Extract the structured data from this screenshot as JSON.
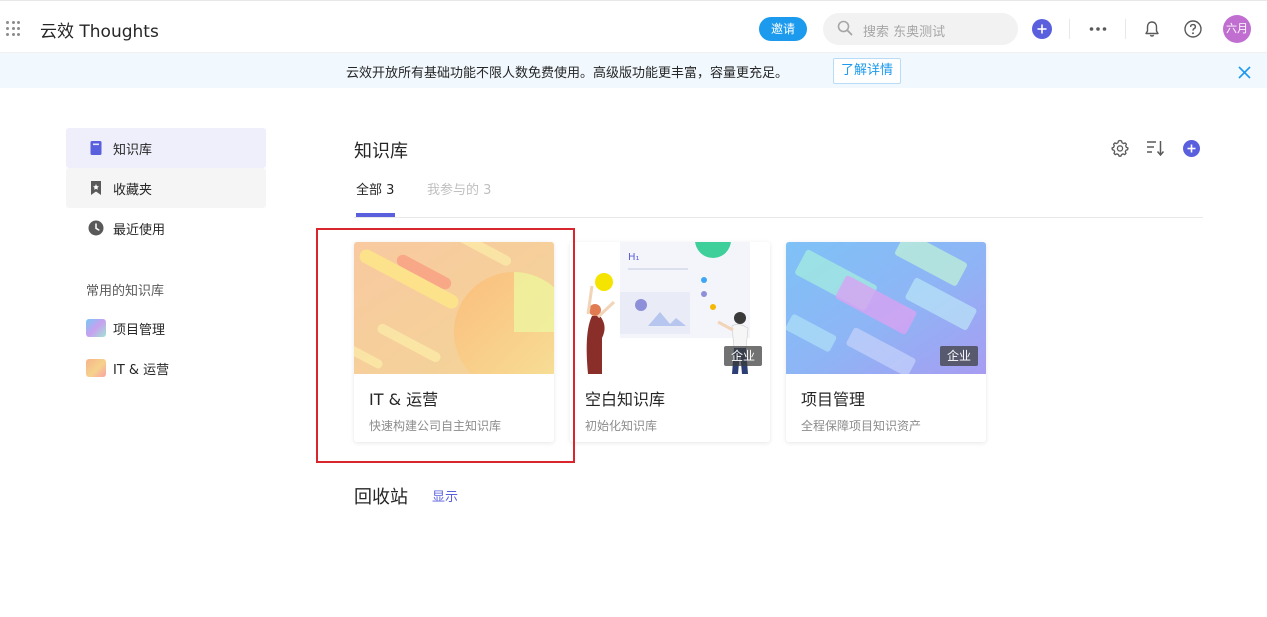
{
  "header": {
    "app_title": "云效 Thoughts",
    "invite_label": "邀请",
    "search_placeholder": "搜索 东奥测试",
    "avatar_text": "六月"
  },
  "banner": {
    "text": "云效开放所有基础功能不限人数免费使用。高级版功能更丰富，容量更充足。",
    "link_label": "了解详情"
  },
  "sidebar": {
    "items": [
      {
        "label": "知识库",
        "icon": "book-icon"
      },
      {
        "label": "收藏夹",
        "icon": "bookmark-icon"
      },
      {
        "label": "最近使用",
        "icon": "clock-icon"
      }
    ],
    "section_title": "常用的知识库",
    "favorites": [
      {
        "label": "项目管理"
      },
      {
        "label": "IT & 运营"
      }
    ]
  },
  "main": {
    "title": "知识库",
    "tabs": [
      {
        "label": "全部 3"
      },
      {
        "label": "我参与的 3"
      }
    ],
    "cards": [
      {
        "name": "IT & 运营",
        "desc": "快速构建公司自主知识库",
        "badge": ""
      },
      {
        "name": "空白知识库",
        "desc": "初始化知识库",
        "badge": "企业"
      },
      {
        "name": "项目管理",
        "desc": "全程保障项目知识资产",
        "badge": "企业"
      }
    ],
    "recycle_title": "回收站",
    "recycle_action": "显示"
  },
  "colors": {
    "accent": "#5a5fde",
    "invite": "#1b9aee",
    "banner_bg": "#f1f8fe",
    "highlight": "#d9262c"
  }
}
